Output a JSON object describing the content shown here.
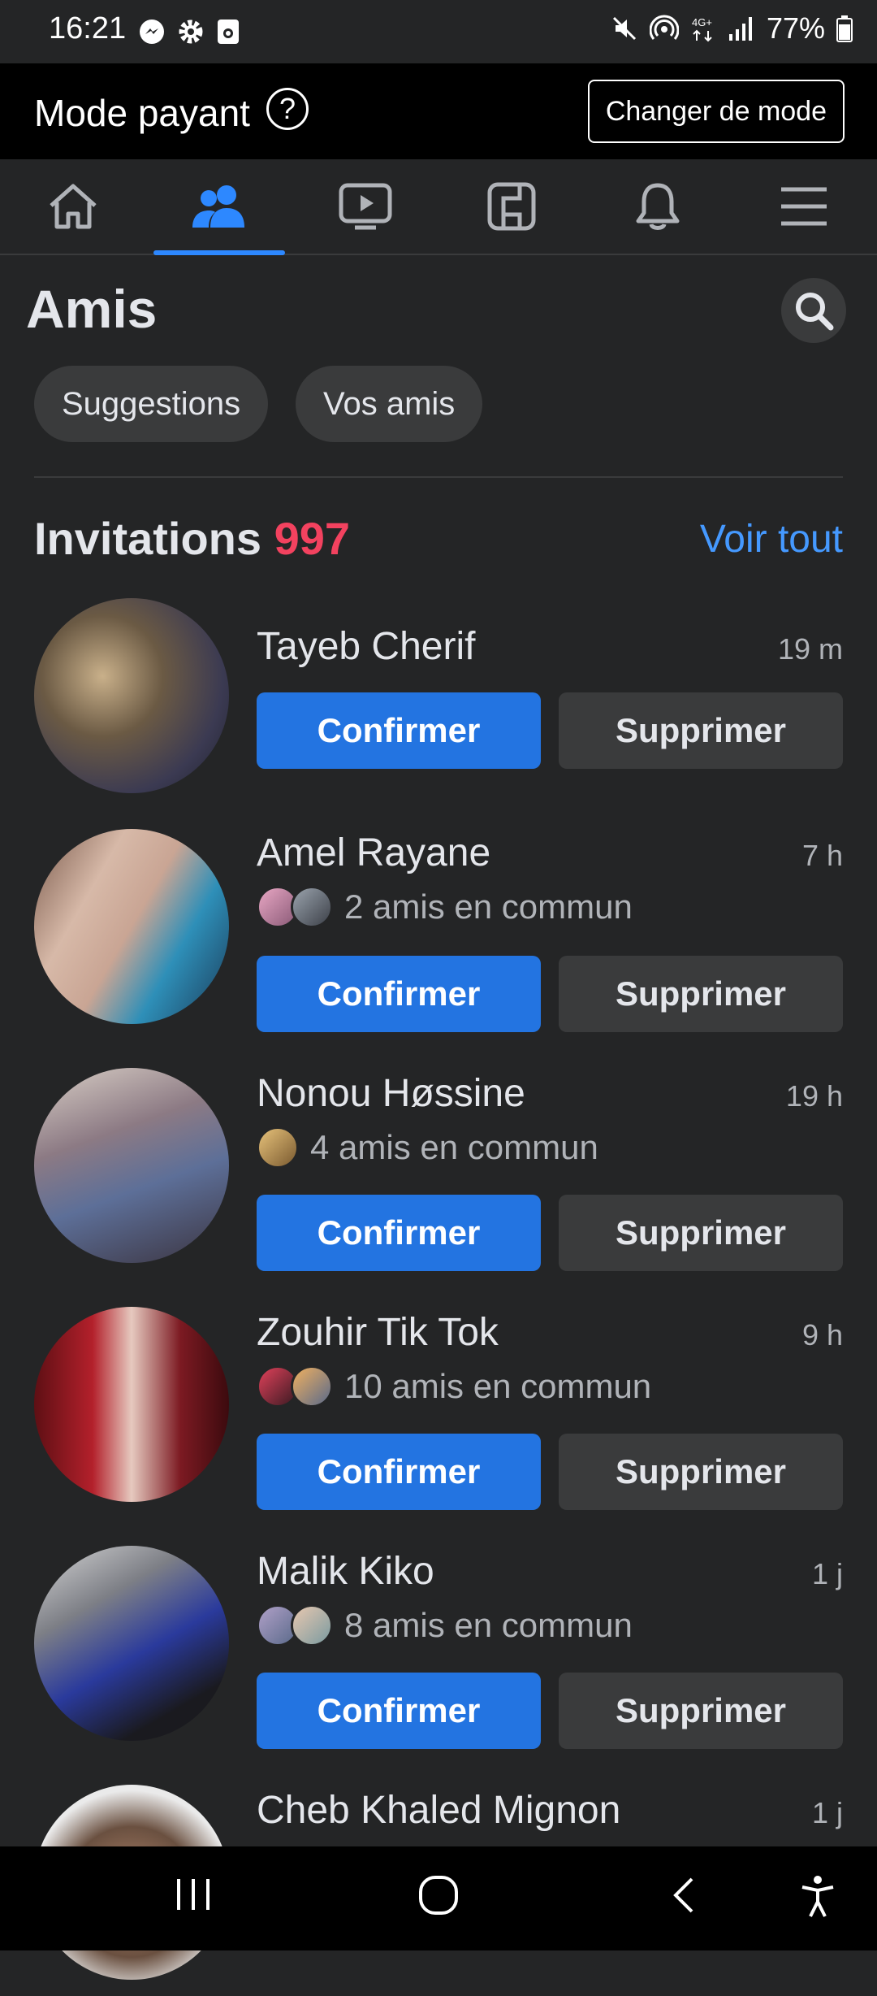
{
  "status_bar": {
    "time": "16:21",
    "left_icons": [
      "messenger-icon",
      "settings-icon",
      "screen-record-icon"
    ],
    "right_icons": [
      "mute-icon",
      "hotspot-icon",
      "4g-icon",
      "signal-icon"
    ],
    "battery": "77%"
  },
  "mode_bar": {
    "title": "Mode payant",
    "help": "?",
    "switch_label": "Changer de mode"
  },
  "nav_tabs": [
    {
      "name": "home-icon",
      "active": false
    },
    {
      "name": "friends-icon",
      "active": true
    },
    {
      "name": "watch-icon",
      "active": false
    },
    {
      "name": "feeds-icon",
      "active": false
    },
    {
      "name": "notifications-icon",
      "active": false
    },
    {
      "name": "menu-icon",
      "active": false
    }
  ],
  "page": {
    "title": "Amis",
    "chips": [
      "Suggestions",
      "Vos amis"
    ]
  },
  "invitations": {
    "title": "Invitations",
    "count": "997",
    "see_all": "Voir tout",
    "confirm_label": "Confirmer",
    "delete_label": "Supprimer",
    "items": [
      {
        "name": "Tayeb Cherif",
        "time": "19 m",
        "mutual": ""
      },
      {
        "name": "Amel Rayane",
        "time": "7 h",
        "mutual": "2 amis en commun"
      },
      {
        "name": "Nonou Høssine",
        "time": "19 h",
        "mutual": "4 amis en commun"
      },
      {
        "name": "Zouhir Tik Tok",
        "time": "9 h",
        "mutual": "10 amis en commun"
      },
      {
        "name": "Malik Kiko",
        "time": "1 j",
        "mutual": "8 amis en commun"
      },
      {
        "name": "Cheb Khaled Mignon",
        "time": "1 j",
        "mutual": ""
      }
    ]
  },
  "system_nav": [
    "recents-icon",
    "home-circle-icon",
    "back-icon",
    "accessibility-icon"
  ],
  "colors": {
    "background": "#242526",
    "accent": "#2374e1",
    "count_red": "#f3425f",
    "link_blue": "#4599ff"
  }
}
